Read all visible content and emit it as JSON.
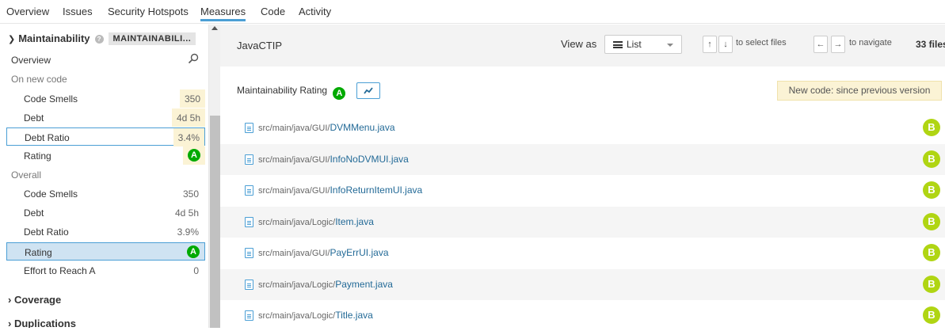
{
  "nav": {
    "tabs": [
      {
        "label": "Overview"
      },
      {
        "label": "Issues"
      },
      {
        "label": "Security Hotspots"
      },
      {
        "label": "Measures",
        "active": true
      },
      {
        "label": "Code"
      },
      {
        "label": "Activity"
      }
    ]
  },
  "sidebar": {
    "header": {
      "title": "Maintainability",
      "tag": "MAINTAINABILI..."
    },
    "overview_label": "Overview",
    "new_code_section": "On new code",
    "new_code_items": [
      {
        "label": "Code Smells",
        "value": "350"
      },
      {
        "label": "Debt",
        "value": "4d 5h"
      },
      {
        "label": "Debt Ratio",
        "value": "3.4%"
      },
      {
        "label": "Rating",
        "value": "A"
      }
    ],
    "overall_section": "Overall",
    "overall_items": [
      {
        "label": "Code Smells",
        "value": "350"
      },
      {
        "label": "Debt",
        "value": "4d 5h"
      },
      {
        "label": "Debt Ratio",
        "value": "3.9%"
      },
      {
        "label": "Rating",
        "value": "A"
      },
      {
        "label": "Effort to Reach A",
        "value": "0"
      }
    ],
    "groups": [
      {
        "label": "Coverage"
      },
      {
        "label": "Duplications"
      }
    ]
  },
  "main": {
    "project": "JavaCTIP",
    "view_as_label": "View as",
    "view_select": "List",
    "keys": {
      "up": "↑",
      "down": "↓",
      "left": "←",
      "right": "→"
    },
    "select_hint": "to select files",
    "navigate_hint": "to navigate",
    "file_count": "33 files",
    "metric_title": "Maintainability Rating",
    "metric_rating": "A",
    "new_code_badge": "New code: since previous version",
    "files": [
      {
        "dir": "src/main/java/GUI/",
        "name": "DVMMenu.java",
        "rating": "B"
      },
      {
        "dir": "src/main/java/GUI/",
        "name": "InfoNoDVMUI.java",
        "rating": "B"
      },
      {
        "dir": "src/main/java/GUI/",
        "name": "InfoReturnItemUI.java",
        "rating": "B"
      },
      {
        "dir": "src/main/java/Logic/",
        "name": "Item.java",
        "rating": "B"
      },
      {
        "dir": "src/main/java/GUI/",
        "name": "PayErrUI.java",
        "rating": "B"
      },
      {
        "dir": "src/main/java/Logic/",
        "name": "Payment.java",
        "rating": "B"
      },
      {
        "dir": "src/main/java/Logic/",
        "name": "Title.java",
        "rating": "B"
      }
    ]
  },
  "colors": {
    "accent": "#4b9fd5",
    "rating_a": "#00aa00",
    "rating_b": "#b0d513",
    "new_code_bg": "#fbf3d5",
    "selected_bg": "#cfe3f2"
  }
}
